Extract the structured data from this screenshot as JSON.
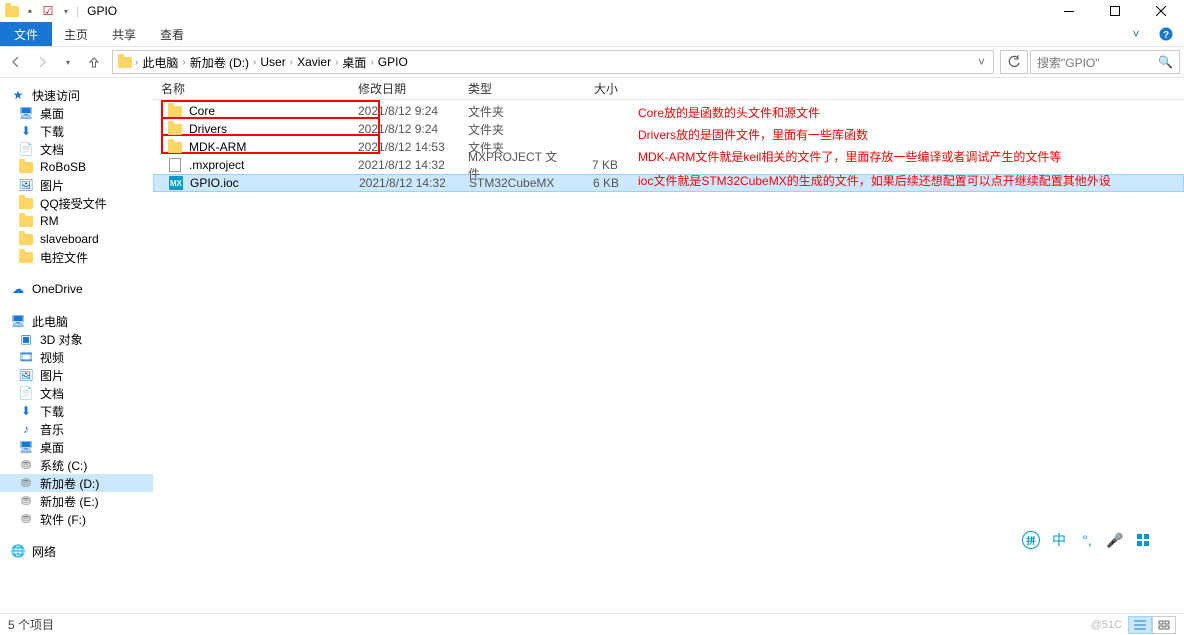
{
  "window": {
    "title": "GPIO",
    "qat_divider": "|"
  },
  "ribbon": {
    "file": "文件",
    "tabs": [
      "主页",
      "共享",
      "查看"
    ]
  },
  "breadcrumb": {
    "items": [
      "此电脑",
      "新加卷 (D:)",
      "User",
      "Xavier",
      "桌面",
      "GPIO"
    ]
  },
  "search": {
    "placeholder": "搜索\"GPIO\""
  },
  "sidebar": {
    "quick_access": "快速访问",
    "quick_items": [
      {
        "icon": "desktop",
        "label": "桌面"
      },
      {
        "icon": "download",
        "label": "下载"
      },
      {
        "icon": "document",
        "label": "文档"
      },
      {
        "icon": "folder",
        "label": "RoBoSB"
      },
      {
        "icon": "pictures",
        "label": "图片"
      },
      {
        "icon": "folder",
        "label": "QQ接受文件"
      },
      {
        "icon": "folder",
        "label": "RM"
      },
      {
        "icon": "folder",
        "label": "slaveboard"
      },
      {
        "icon": "folder",
        "label": "电控文件"
      }
    ],
    "onedrive": "OneDrive",
    "this_pc": "此电脑",
    "pc_items": [
      {
        "icon": "3d",
        "label": "3D 对象"
      },
      {
        "icon": "video",
        "label": "视频"
      },
      {
        "icon": "pictures",
        "label": "图片"
      },
      {
        "icon": "document",
        "label": "文档"
      },
      {
        "icon": "download",
        "label": "下载"
      },
      {
        "icon": "music",
        "label": "音乐"
      },
      {
        "icon": "desktop",
        "label": "桌面"
      },
      {
        "icon": "disk",
        "label": "系统 (C:)"
      },
      {
        "icon": "disk",
        "label": "新加卷 (D:)",
        "selected": true
      },
      {
        "icon": "disk",
        "label": "新加卷 (E:)"
      },
      {
        "icon": "disk",
        "label": "软件 (F:)"
      }
    ],
    "network": "网络"
  },
  "columns": {
    "name": "名称",
    "date": "修改日期",
    "type": "类型",
    "size": "大小"
  },
  "files": [
    {
      "icon": "folder",
      "name": "Core",
      "date": "2021/8/12 9:24",
      "type": "文件夹",
      "size": ""
    },
    {
      "icon": "folder",
      "name": "Drivers",
      "date": "2021/8/12 9:24",
      "type": "文件夹",
      "size": ""
    },
    {
      "icon": "folder",
      "name": "MDK-ARM",
      "date": "2021/8/12 14:53",
      "type": "文件夹",
      "size": ""
    },
    {
      "icon": "blank",
      "name": ".mxproject",
      "date": "2021/8/12 14:32",
      "type": "MXPROJECT 文件",
      "size": "7 KB"
    },
    {
      "icon": "mx",
      "name": "GPIO.ioc",
      "date": "2021/8/12 14:32",
      "type": "STM32CubeMX",
      "size": "6 KB",
      "selected": true
    }
  ],
  "annotations": [
    "Core放的是函数的头文件和源文件",
    "Drivers放的是固件文件，里面有一些库函数",
    "MDK-ARM文件就是keil相关的文件了，里面存放一些编译或者调试产生的文件等",
    "ioc文件就是STM32CubeMX的生成的文件，如果后续还想配置可以点开继续配置其他外设"
  ],
  "status": {
    "items": "5 个项目",
    "watermark": "@51C"
  },
  "icon_glyphs": {
    "mx": "MX"
  }
}
